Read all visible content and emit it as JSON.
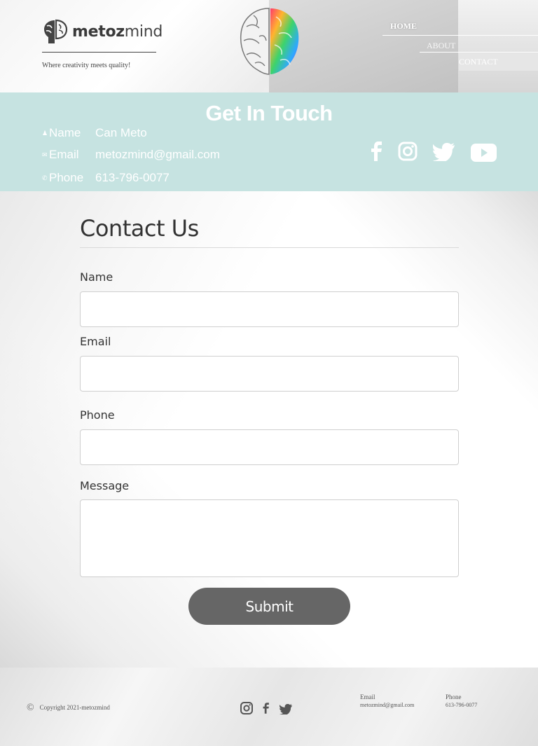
{
  "header": {
    "brand_bold": "metoz",
    "brand_light": "mind",
    "tagline": "Where creativity meets quality!",
    "nav": {
      "home": "HOME",
      "about": "ABOUT",
      "contact": "CONTACT"
    }
  },
  "touch": {
    "title": "Get In Touch",
    "name_label": "Name",
    "name_value": "Can Meto",
    "email_label": "Email",
    "email_value": "metozmind@gmail.com",
    "phone_label": "Phone",
    "phone_value": "613-796-0077",
    "social_icons": [
      "facebook-icon",
      "instagram-icon",
      "twitter-icon",
      "youtube-icon"
    ]
  },
  "form": {
    "title": "Contact Us",
    "name_label": "Name",
    "email_label": "Email",
    "phone_label": "Phone",
    "message_label": "Message",
    "name_value": "",
    "email_value": "",
    "phone_value": "",
    "message_value": "",
    "submit_label": "Submit"
  },
  "footer": {
    "copyright": "Copyright 2021-metozmind",
    "email_title": "Email",
    "email_value": "metozmind@gmail.com",
    "phone_title": "Phone",
    "phone_value": "613-796-0077",
    "social_icons": [
      "instagram-icon",
      "facebook-icon",
      "twitter-icon"
    ]
  },
  "colors": {
    "accent_band": "#c6e3e1",
    "button": "#666666"
  }
}
